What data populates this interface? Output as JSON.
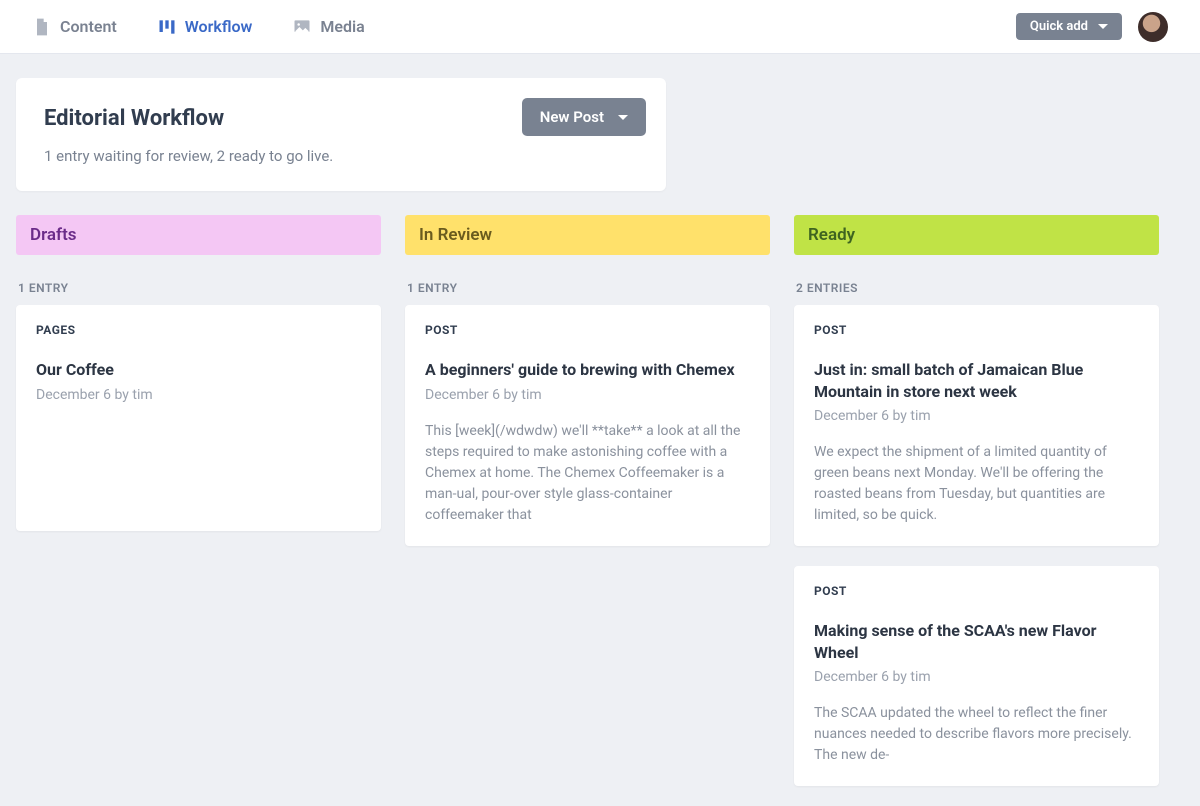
{
  "nav": {
    "content": "Content",
    "workflow": "Workflow",
    "media": "Media",
    "quick_add": "Quick add"
  },
  "header": {
    "title": "Editorial Workflow",
    "subtitle": "1 entry waiting for review, 2 ready to go live.",
    "new_post": "New Post"
  },
  "columns": {
    "drafts": {
      "label": "Drafts",
      "count": "1 ENTRY",
      "cards": [
        {
          "kind": "PAGES",
          "title": "Our Coffee",
          "meta": "December 6 by tim",
          "excerpt": ""
        }
      ]
    },
    "review": {
      "label": "In Review",
      "count": "1 ENTRY",
      "cards": [
        {
          "kind": "POST",
          "title": "A beginners' guide to brewing with Chemex",
          "meta": "December 6 by tim",
          "excerpt": "This [week](/wdwdw) we'll **take** a look at all the steps required to make astonishing coffee with a Chemex at home. The Chemex Coffeemaker is a man-ual, pour-over style glass-container coffeemaker that"
        }
      ]
    },
    "ready": {
      "label": "Ready",
      "count": "2 ENTRIES",
      "cards": [
        {
          "kind": "POST",
          "title": "Just in: small batch of Jamaican Blue Mountain in store next week",
          "meta": "December 6 by tim",
          "excerpt": "We expect the shipment of a limited quantity of green beans next Monday. We'll be offering the roasted beans from Tuesday, but quantities are limited, so be quick."
        },
        {
          "kind": "POST",
          "title": "Making sense of the SCAA's new Flavor Wheel",
          "meta": "December 6 by tim",
          "excerpt": "The SCAA updated the wheel to reflect the finer nuances needed to describe flavors more precisely. The new de-"
        }
      ]
    }
  }
}
